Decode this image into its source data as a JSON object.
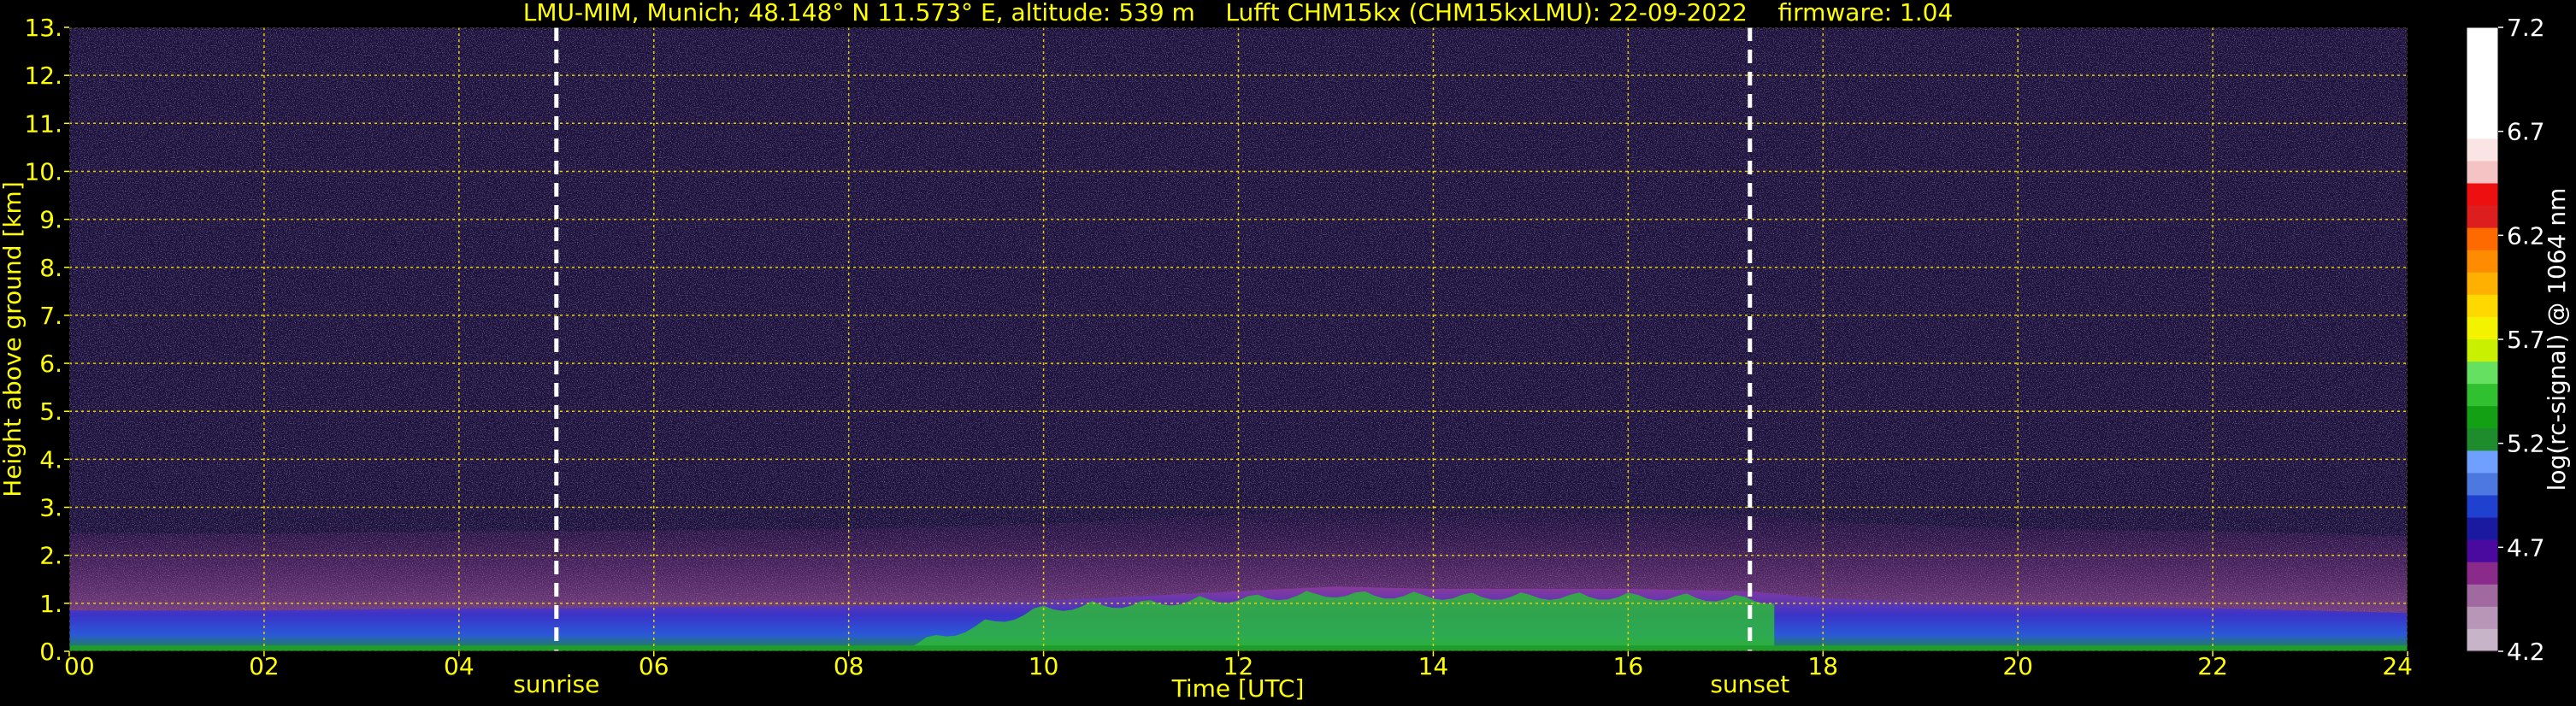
{
  "chart_data": {
    "type": "heatmap",
    "title": "LMU-MIM, Munich; 48.148° N 11.573° E, altitude: 539 m    Lufft CHM15kx (CHM15kxLMU): 22-09-2022    firmware: 1.04",
    "xlabel": "Time [UTC]",
    "ylabel": "Height above ground [km]",
    "xlim": [
      0,
      24
    ],
    "ylim": [
      0,
      13
    ],
    "x_ticks": [
      "00",
      "02",
      "04",
      "06",
      "08",
      "10",
      "12",
      "14",
      "16",
      "18",
      "20",
      "22",
      "24"
    ],
    "y_ticks": [
      "0.",
      "1.",
      "2.",
      "3.",
      "4.",
      "5.",
      "6.",
      "7.",
      "8.",
      "9.",
      "10.",
      "11.",
      "12.",
      "13."
    ],
    "grid": true,
    "markers": [
      {
        "label": "sunrise",
        "x": 5.0
      },
      {
        "label": "sunset",
        "x": 17.25
      }
    ],
    "layer_top_km": [
      [
        0,
        0.85
      ],
      [
        2,
        0.85
      ],
      [
        4,
        0.9
      ],
      [
        5,
        0.9
      ],
      [
        6,
        0.92
      ],
      [
        8,
        0.95
      ],
      [
        10,
        1.05
      ],
      [
        12,
        1.25
      ],
      [
        13,
        1.35
      ],
      [
        14,
        1.3
      ],
      [
        16,
        1.3
      ],
      [
        17.25,
        1.25
      ],
      [
        18,
        1.1
      ],
      [
        20,
        0.95
      ],
      [
        22,
        0.9
      ],
      [
        24,
        0.8
      ]
    ],
    "colorbar": {
      "label": "log(rc-signal) @ 1064 nm",
      "min": 4.2,
      "max": 7.2,
      "ticks": [
        "7.2",
        "6.7",
        "6.2",
        "5.7",
        "5.2",
        "4.7",
        "4.2"
      ],
      "colors": [
        "#ffffff",
        "#ffffff",
        "#ffffff",
        "#ffffff",
        "#ffffff",
        "#fbe4e4",
        "#f4c4c4",
        "#ee1010",
        "#dd1e1e",
        "#ff6a00",
        "#ff8c00",
        "#ffb000",
        "#ffd800",
        "#f3f300",
        "#c8f000",
        "#66e060",
        "#30c030",
        "#14a014",
        "#1e8c2c",
        "#70a0ff",
        "#4c78e0",
        "#2040d0",
        "#1a1aa0",
        "#4a0aa0",
        "#8a2a8a",
        "#a06aa0",
        "#b896b8",
        "#c8b4c8"
      ]
    }
  }
}
